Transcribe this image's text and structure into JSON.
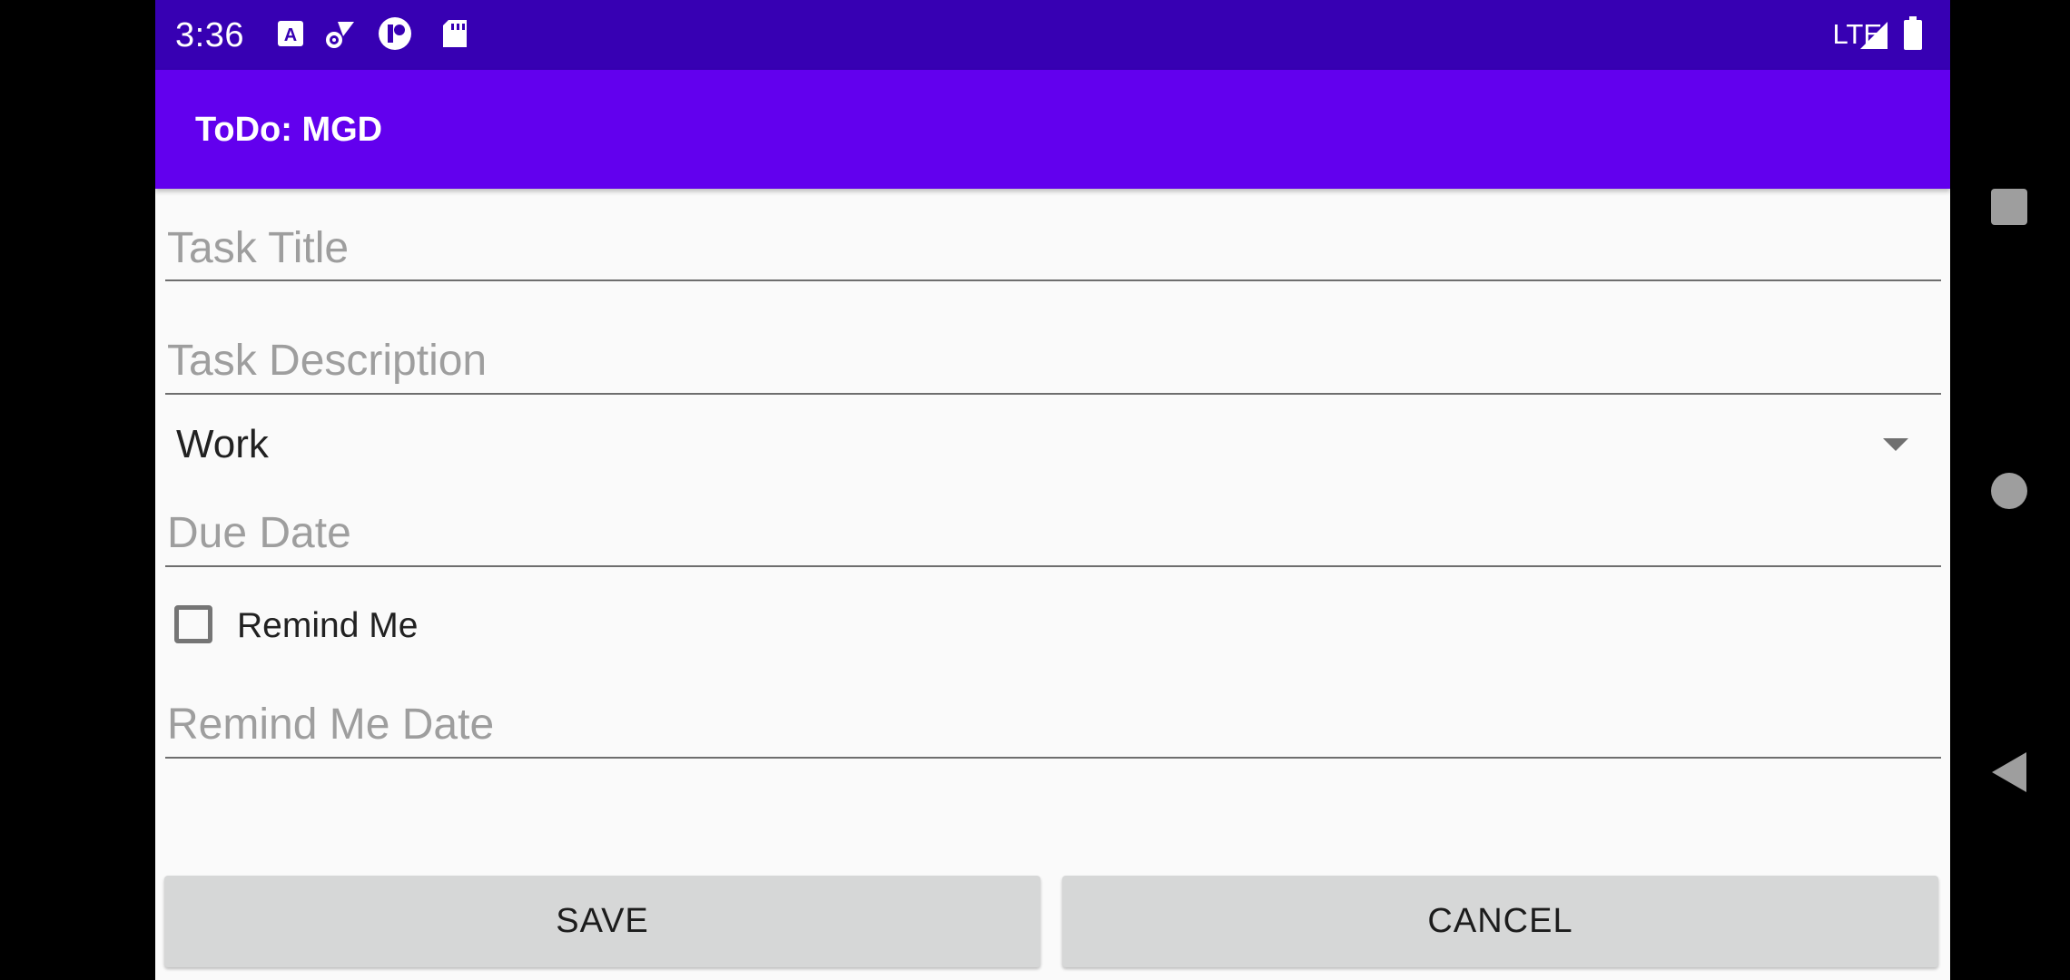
{
  "status_bar": {
    "time": "3:36",
    "network": "LTE",
    "icons": [
      "accessibility-a-icon",
      "wifi-settings-icon",
      "app-notification-icon",
      "sd-card-icon",
      "signal-icon",
      "battery-icon"
    ]
  },
  "app_bar": {
    "title": "ToDo: MGD"
  },
  "form": {
    "task_title": {
      "value": "",
      "placeholder": "Task Title"
    },
    "task_description": {
      "value": "",
      "placeholder": "Task Description"
    },
    "category_spinner": {
      "selected": "Work"
    },
    "due_date": {
      "value": "",
      "placeholder": "Due Date"
    },
    "remind_me": {
      "label": "Remind Me",
      "checked": false
    },
    "remind_me_date": {
      "value": "",
      "placeholder": "Remind Me Date"
    }
  },
  "buttons": {
    "save_label": "SAVE",
    "cancel_label": "CANCEL"
  },
  "colors": {
    "status_bar": "#3700b3",
    "app_bar": "#6200ee",
    "background": "#fafafa",
    "button": "#d6d7d7"
  }
}
